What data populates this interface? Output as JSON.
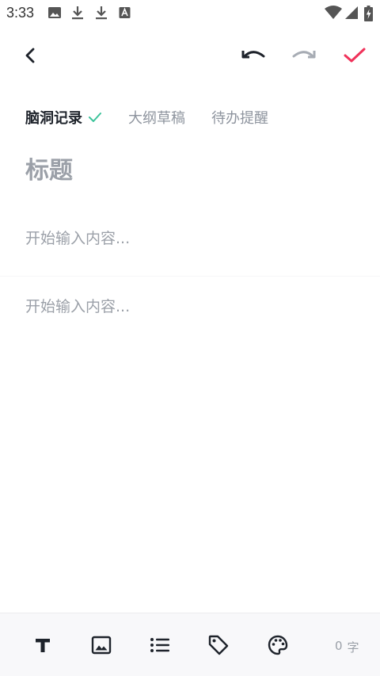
{
  "status_bar": {
    "time": "3:33",
    "icons": [
      "image-icon",
      "download-icon",
      "download-icon",
      "a-badge-icon",
      "wifi-icon",
      "signal-icon",
      "battery-charging-icon"
    ]
  },
  "header": {
    "icons": [
      "back-arrow-icon",
      "undo-icon",
      "redo-icon",
      "checkmark-icon"
    ],
    "colors": {
      "undo": "#1e232b",
      "redo": "#a7acb4",
      "done": "#f0325a"
    }
  },
  "tabs": [
    {
      "label": "脑洞记录",
      "active": true
    },
    {
      "label": "大纲草稿",
      "active": false
    },
    {
      "label": "待办提醒",
      "active": false
    }
  ],
  "editor": {
    "title_placeholder": "标题",
    "content_placeholder_1": "开始输入内容...",
    "content_placeholder_2": "开始输入内容..."
  },
  "bottom_toolbar": {
    "tools": [
      "text-format-icon",
      "image-icon",
      "list-icon",
      "tag-icon",
      "palette-icon"
    ],
    "word_count": "0",
    "word_unit": "字"
  },
  "colors": {
    "active_check": "#3cc39a",
    "placeholder": "#9ba0a8",
    "text_dark": "#1e232b",
    "toolbar_bg": "#f8f8fa"
  }
}
